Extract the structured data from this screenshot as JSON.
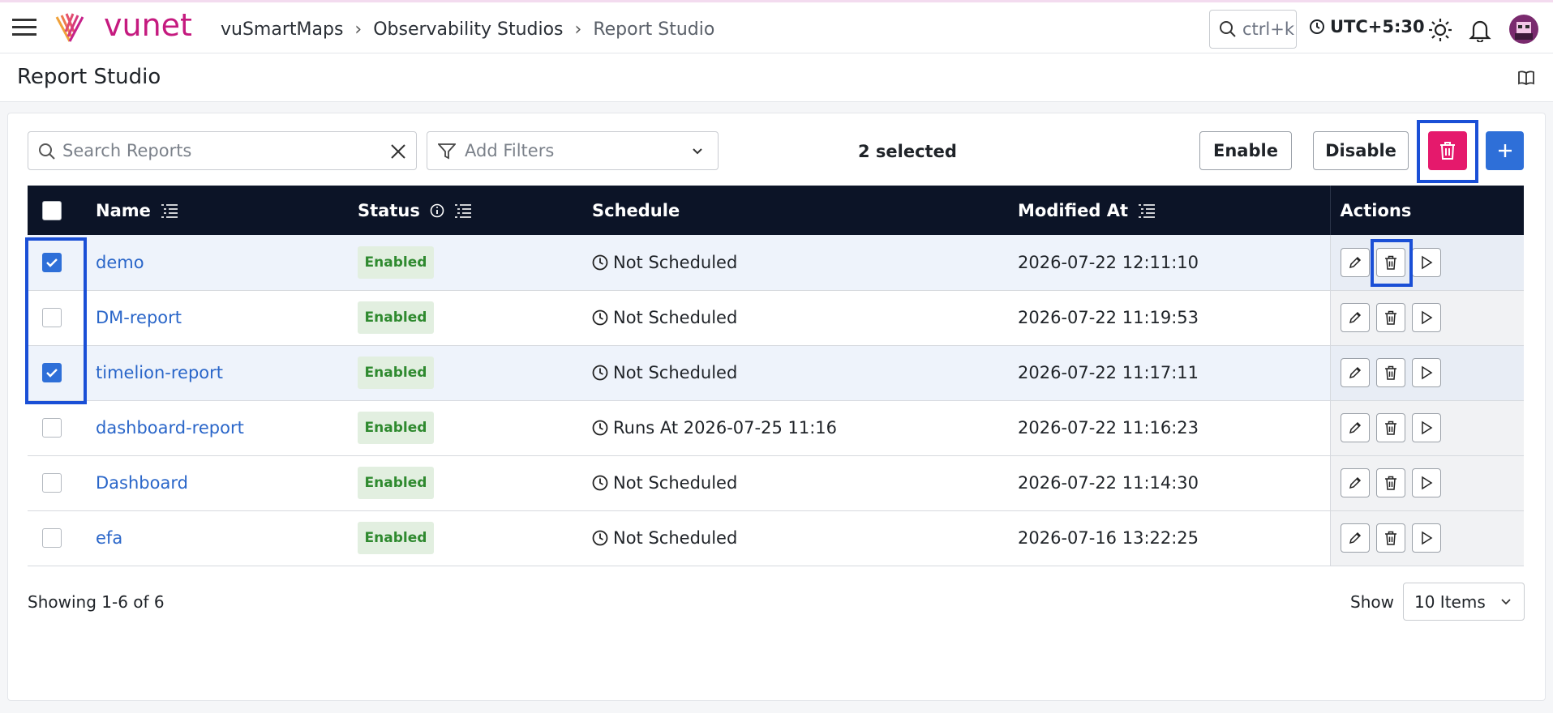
{
  "topbar": {
    "brand": "vunet",
    "breadcrumb": [
      "vuSmartMaps",
      "Observability Studios",
      "Report Studio"
    ],
    "search_placeholder": "ctrl+k",
    "timezone": "UTC+5:30"
  },
  "page": {
    "title": "Report Studio"
  },
  "toolbar": {
    "search_placeholder": "Search Reports",
    "filters_label": "Add Filters",
    "selected_text": "2 selected",
    "enable_label": "Enable",
    "disable_label": "Disable",
    "delete_color": "#e5196c",
    "add_color": "#2e6fd8"
  },
  "table": {
    "columns": [
      "Name",
      "Status",
      "Schedule",
      "Modified At",
      "Actions"
    ],
    "rows": [
      {
        "name": "demo",
        "status": "Enabled",
        "schedule": "Not Scheduled",
        "modified": "2026-07-22 12:11:10",
        "selected": true
      },
      {
        "name": "DM-report",
        "status": "Enabled",
        "schedule": "Not Scheduled",
        "modified": "2026-07-22 11:19:53",
        "selected": false
      },
      {
        "name": "timelion-report",
        "status": "Enabled",
        "schedule": "Not Scheduled",
        "modified": "2026-07-22 11:17:11",
        "selected": true
      },
      {
        "name": "dashboard-report",
        "status": "Enabled",
        "schedule": "Runs At 2026-07-25 11:16",
        "modified": "2026-07-22 11:16:23",
        "selected": false
      },
      {
        "name": "Dashboard",
        "status": "Enabled",
        "schedule": "Not Scheduled",
        "modified": "2026-07-22 11:14:30",
        "selected": false
      },
      {
        "name": "efa",
        "status": "Enabled",
        "schedule": "Not Scheduled",
        "modified": "2026-07-16 13:22:25",
        "selected": false
      }
    ]
  },
  "footer": {
    "showing": "Showing 1-6 of 6",
    "show_label": "Show",
    "page_size": "10 Items"
  }
}
